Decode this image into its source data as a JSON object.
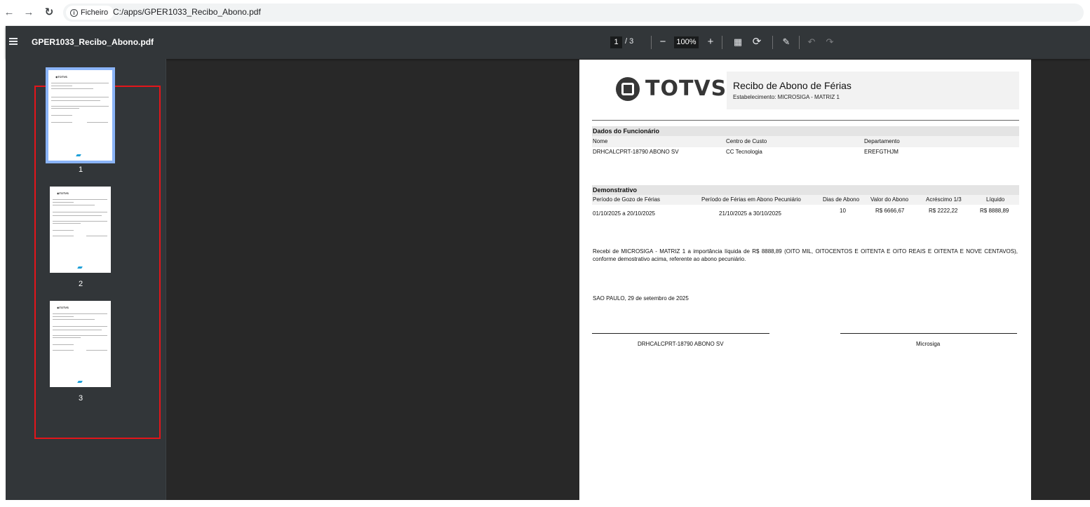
{
  "browser": {
    "site_label": "Ficheiro",
    "url": "C:/apps/GPER1033_Recibo_Abono.pdf"
  },
  "toolbar": {
    "document_title": "GPER1033_Recibo_Abono.pdf",
    "current_page": "1",
    "total_pages": "/ 3",
    "zoom": "100%"
  },
  "sidebar": {
    "thumbnails": [
      {
        "label": "1",
        "selected": true
      },
      {
        "label": "2",
        "selected": false
      },
      {
        "label": "3",
        "selected": false
      }
    ]
  },
  "document": {
    "logo_text": "TOTVS",
    "title": "Recibo de Abono de Férias",
    "establishment": "Estabelecimento: MICROSIGA - MATRIZ 1",
    "employee_section": {
      "heading": "Dados do Funcionário",
      "headers": [
        "Nome",
        "Centro de Custo",
        "Departamento"
      ],
      "values": [
        "DRHCALCPRT-18790 ABONO SV",
        "CC Tecnologia",
        "EREFGTHJM"
      ]
    },
    "statement_section": {
      "heading": "Demonstrativo",
      "headers": [
        "Período de Gozo de Férias",
        "Período de Férias em Abono Pecuniário",
        "Dias de Abono",
        "Valor do Abono",
        "Acréscimo 1/3",
        "Líquido"
      ],
      "values": [
        "01/10/2025 a 20/10/2025",
        "21/10/2025 a 30/10/2025",
        "10",
        "R$ 6666,67",
        "R$ 2222,22",
        "R$ 8888,89"
      ]
    },
    "receipt_text": "Recebi de MICROSIGA - MATRIZ 1 a importância líquida de R$ 8888,89 (OITO MIL, OITOCENTOS E OITENTA E OITO REAIS E OITENTA E NOVE CENTAVOS), conforme demostrativo acima, referente ao abono pecuniário.",
    "place_date": "SAO PAULO,  29 de setembro de 2025",
    "signatures": [
      "DRHCALCPRT-18790 ABONO SV",
      "Microsiga"
    ]
  },
  "colors": {
    "viewer_background": "#282828",
    "toolbar_background": "#323639",
    "selection_outline": "#8ab4f8",
    "highlight_box": "#e3151a"
  }
}
